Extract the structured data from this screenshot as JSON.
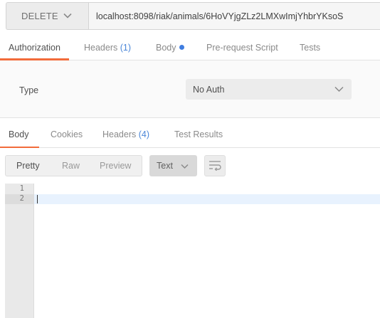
{
  "request": {
    "method": "DELETE",
    "url": "localhost:8098/riak/animals/6HoVYjgZLz2LMXwImjYhbrYKsoS"
  },
  "request_tabs": [
    {
      "label": "Authorization",
      "active": true
    },
    {
      "label": "Headers",
      "count": "(1)"
    },
    {
      "label": "Body",
      "indicator": "dot"
    },
    {
      "label": "Pre-request Script"
    },
    {
      "label": "Tests"
    }
  ],
  "auth": {
    "type_label": "Type",
    "type_value": "No Auth"
  },
  "response_tabs": [
    {
      "label": "Body",
      "active": true
    },
    {
      "label": "Cookies"
    },
    {
      "label": "Headers",
      "count": "(4)"
    },
    {
      "label": "Test Results"
    }
  ],
  "response_toolbar": {
    "view_modes": [
      "Pretty",
      "Raw",
      "Preview"
    ],
    "active_view": "Pretty",
    "format": "Text",
    "wrap_icon": "wrap-lines-icon"
  },
  "editor": {
    "line_numbers": [
      "1",
      "2"
    ],
    "active_line": 2
  },
  "colors": {
    "accent": "#f26b3a",
    "count": "#4a86d8",
    "dot": "#3f7de0",
    "active_line": "#e8f2fe"
  }
}
